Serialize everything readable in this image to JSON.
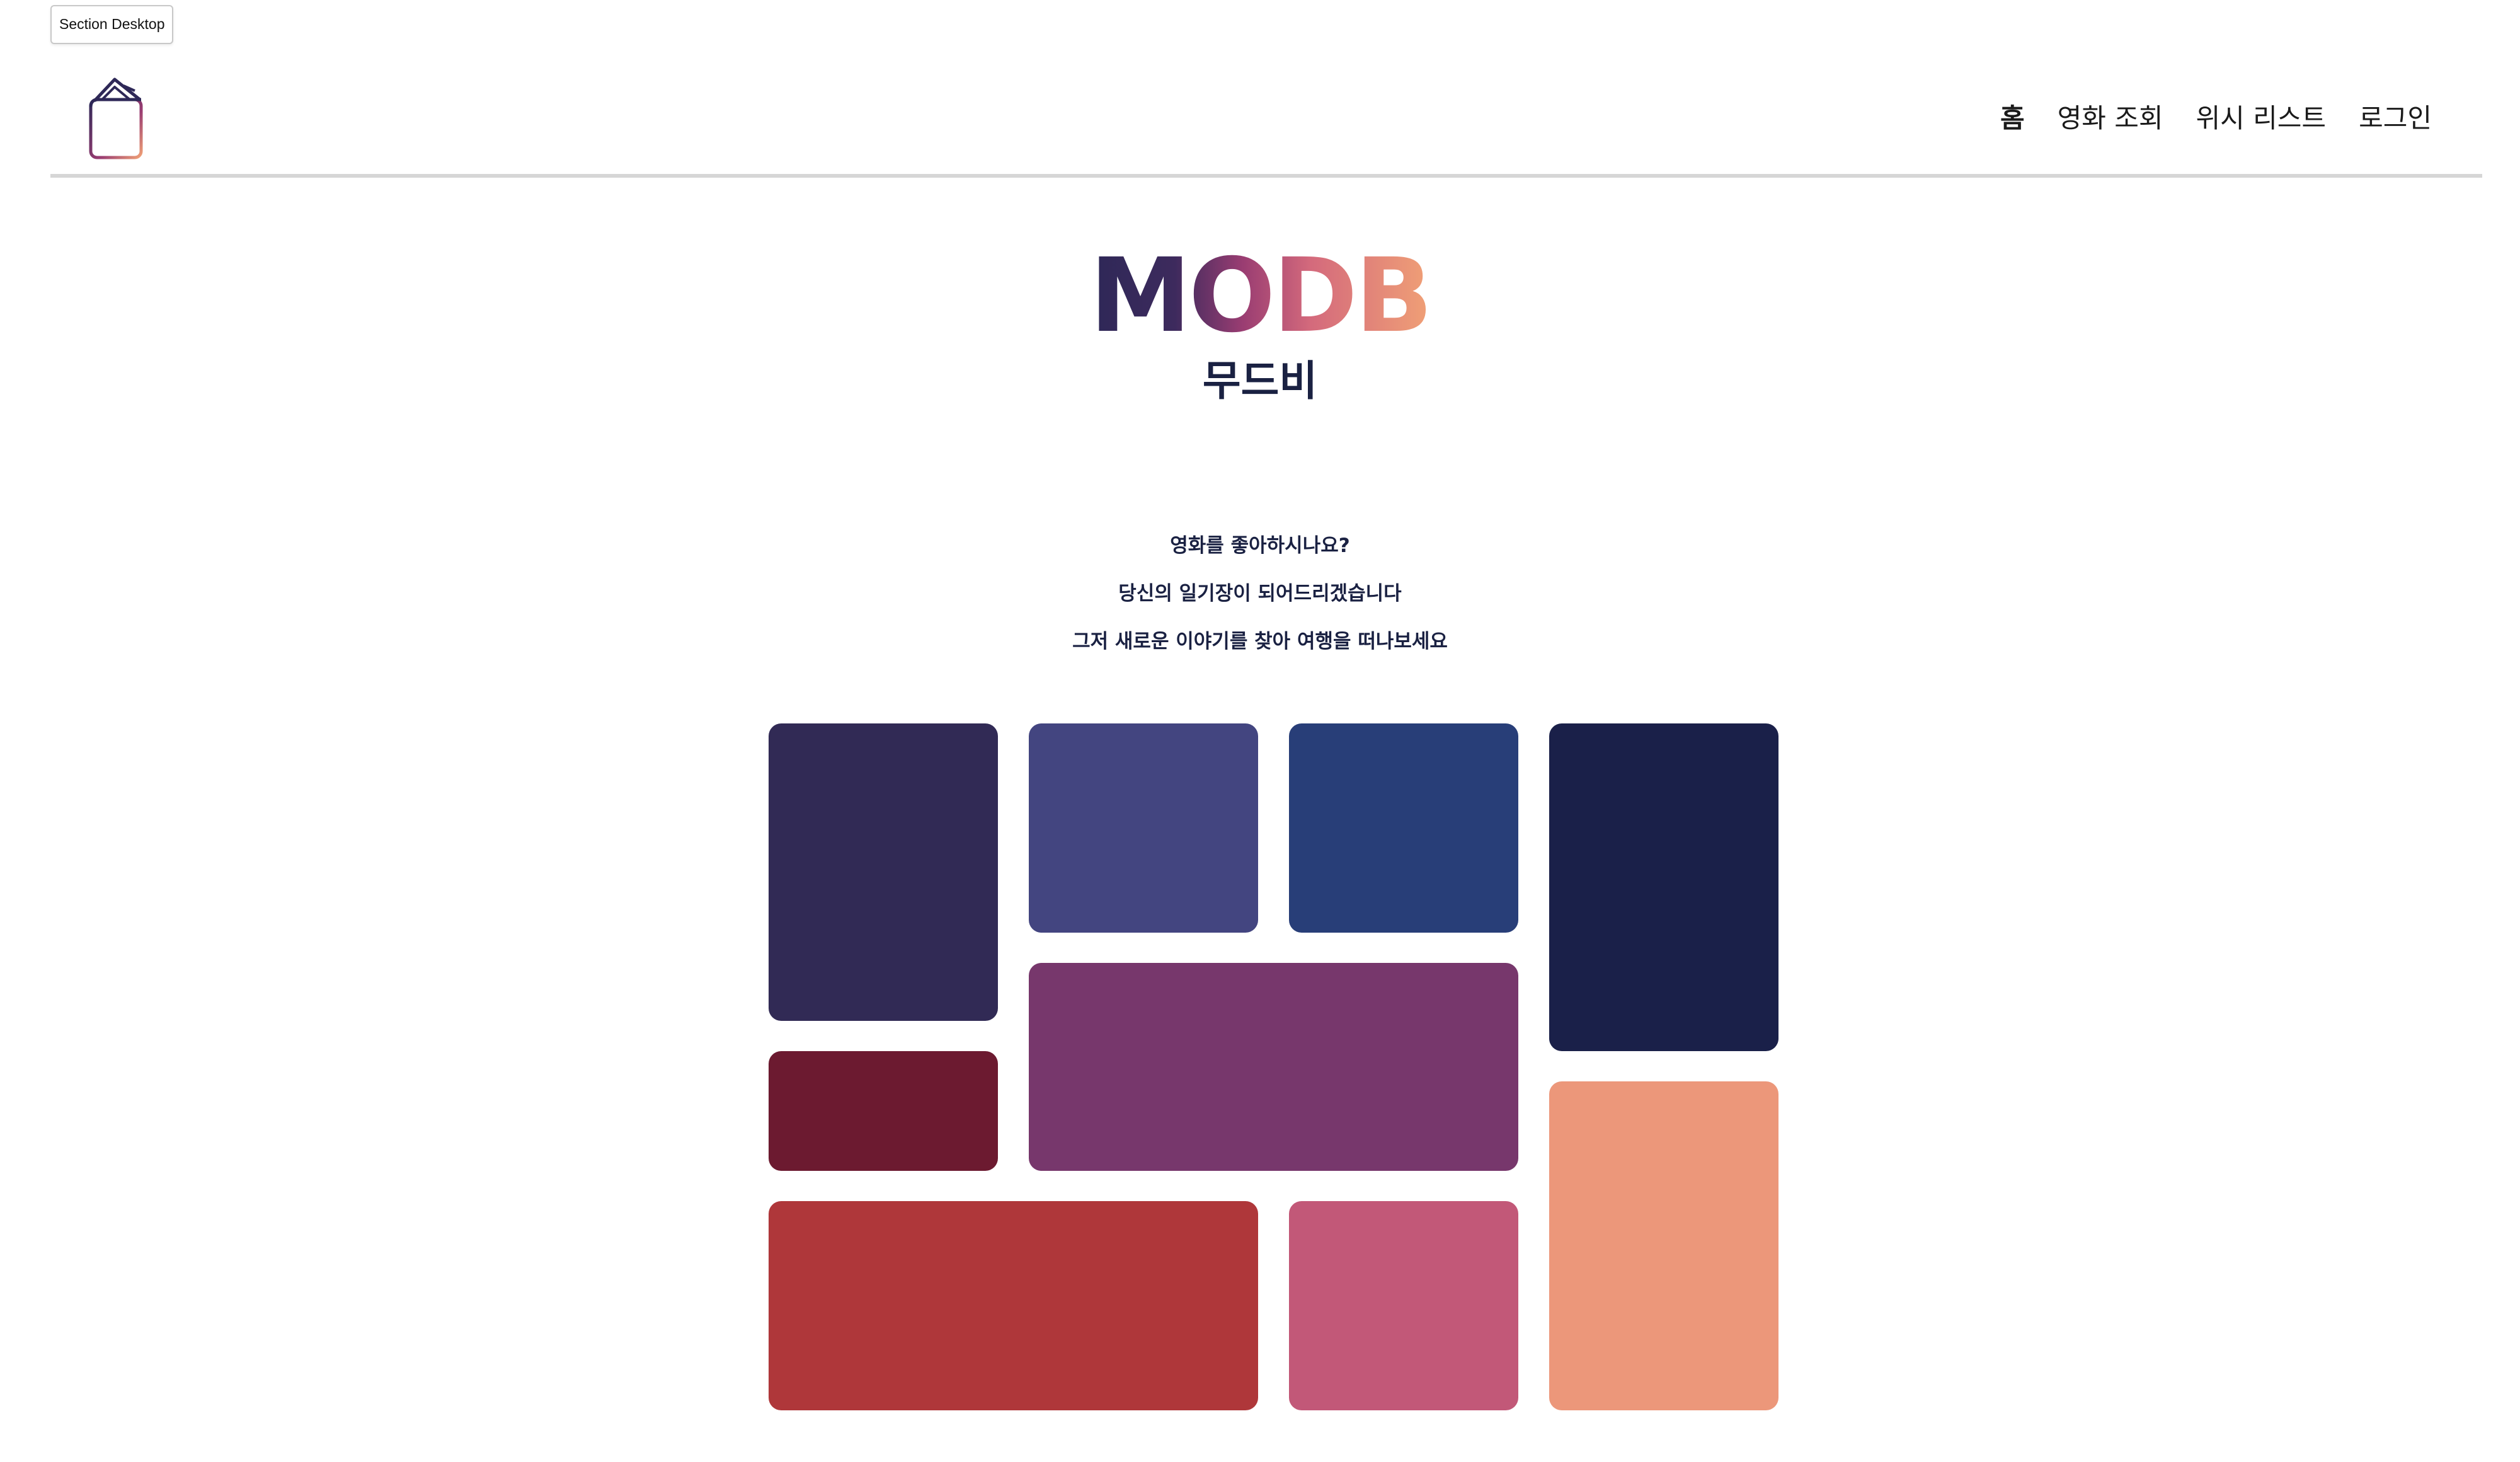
{
  "section_tag": "Section Desktop",
  "nav": {
    "items": [
      {
        "label": "홈"
      },
      {
        "label": "영화 조회"
      },
      {
        "label": "위시 리스트"
      },
      {
        "label": "로그인"
      }
    ]
  },
  "hero": {
    "title": "MODB",
    "subtitle": "무드비"
  },
  "taglines": [
    "영화를 좋아하시나요?",
    "당신의 일기장이 되어드리겠습니다",
    "그저 새로운 이야기를 찾아 여행을 떠나보세요"
  ],
  "mood_tiles": [
    {
      "color": "#312a55"
    },
    {
      "color": "#434580"
    },
    {
      "color": "#283e78"
    },
    {
      "color": "#1a2049"
    },
    {
      "color": "#6c1a30"
    },
    {
      "color": "#77376c"
    },
    {
      "color": "#ec977a"
    },
    {
      "color": "#af373a"
    },
    {
      "color": "#c25878"
    }
  ],
  "colors": {
    "accent_dark": "#1a2142",
    "divider": "#d6d6d6"
  }
}
